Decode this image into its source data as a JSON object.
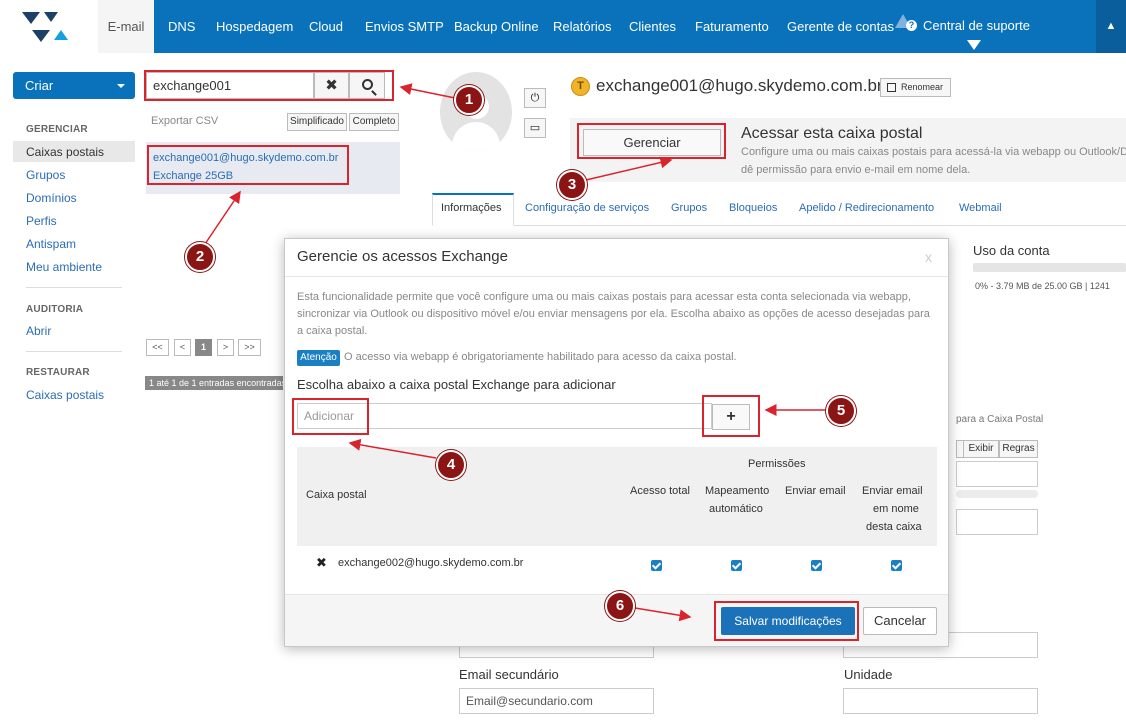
{
  "nav": {
    "items": [
      "E-mail",
      "DNS",
      "Hospedagem",
      "Cloud",
      "Envios SMTP",
      "Backup Online",
      "Relatórios",
      "Clientes",
      "Faturamento",
      "Gerente de contas"
    ],
    "support": "Central de suporte",
    "bell_icon": "bell-icon"
  },
  "sidebar": {
    "create_label": "Criar",
    "sections": [
      {
        "heading": "GERENCIAR",
        "items": [
          "Caixas postais",
          "Grupos",
          "Domínios",
          "Perfis",
          "Antispam",
          "Meu ambiente"
        ]
      },
      {
        "heading": "AUDITORIA",
        "items": [
          "Abrir"
        ]
      },
      {
        "heading": "RESTAURAR",
        "items": [
          "Caixas postais"
        ]
      }
    ],
    "active_item": "Caixas postais"
  },
  "search": {
    "value": "exchange001",
    "export_csv": "Exportar CSV",
    "simplified": "Simplificado",
    "complete": "Completo",
    "result": {
      "email": "exchange001@hugo.skydemo.com.br",
      "plan": "Exchange 25GB"
    },
    "pagination": [
      "<<",
      "<",
      "1",
      ">",
      ">>"
    ],
    "entries": "1 até 1 de 1 entradas encontradas"
  },
  "account": {
    "badge": "T",
    "email": "exchange001@hugo.skydemo.com.br",
    "rename": "Renomear",
    "access": {
      "button": "Gerenciar",
      "title": "Acessar esta caixa postal",
      "desc1": "Configure uma ou mais caixas postais para acessá-la via webapp ou Outlook/D",
      "desc2": "dê permissão para envio e-mail em nome dela."
    },
    "tabs": [
      "Informações",
      "Configuração de serviços",
      "Grupos",
      "Bloqueios",
      "Apelido / Redirecionamento",
      "Webmail"
    ],
    "usage_label": "Uso da conta",
    "usage_text": "0% - 3.79 MB de 25.00 GB | 1241",
    "usage_fraction": 0.0,
    "right_label": "para a Caixa Postal",
    "right_buttons": [
      "Exibir",
      "Regras"
    ],
    "secondary_email_label": "Email secundário",
    "secondary_email_value": "Email@secundario.com",
    "unit_label": "Unidade"
  },
  "modal": {
    "title": "Gerencie os acessos Exchange",
    "close": "x",
    "desc": [
      "Esta funcionalidade permite que você configure uma ou mais caixas postais para acessar esta conta selecionada via webapp,",
      "sincronizar via Outlook ou dispositivo móvel e/ou enviar mensagens por ela. Escolha abaixo as opções de acesso desejadas para",
      "a caixa postal."
    ],
    "attention_badge": "Atenção",
    "attention_text": "O acesso via webapp é obrigatoriamente habilitado para acesso da caixa postal.",
    "choose_title": "Escolha abaixo a caixa postal Exchange para adicionar",
    "add_placeholder": "Adicionar",
    "add_button": "+",
    "table": {
      "col_mailbox": "Caixa postal",
      "permissions": "Permissões",
      "col_full": "Acesso total",
      "col_map": [
        "Mapeamento",
        "automático"
      ],
      "col_send": "Enviar email",
      "col_send_on_behalf": [
        "Enviar email",
        "em nome",
        "desta caixa"
      ],
      "rows": [
        {
          "email": "exchange002@hugo.skydemo.com.br",
          "full": true,
          "map": true,
          "send": true,
          "on_behalf": true
        }
      ]
    },
    "save": "Salvar modificações",
    "cancel": "Cancelar"
  },
  "callouts": [
    "1",
    "2",
    "3",
    "4",
    "5",
    "6"
  ],
  "colors": {
    "brand": "#0a72ba",
    "highlight": "#d9232d",
    "callout": "#8b1414"
  }
}
